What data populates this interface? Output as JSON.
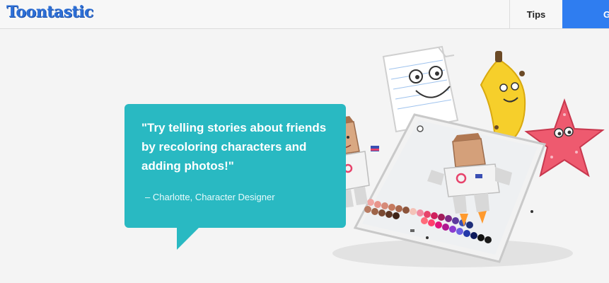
{
  "header": {
    "logo_text": "Toontastic",
    "tips_label": "Tips",
    "cta_label": "G"
  },
  "bubble": {
    "quote": "\"Try telling stories about friends by recoloring characters and adding photos!\"",
    "attribution": "– Charlotte, Character Designer"
  },
  "colors": {
    "brand_blue": "#2f7df0",
    "bubble_teal": "#29b9c2",
    "background": "#f4f4f4"
  },
  "icons": [
    "paper-character-icon",
    "banana-character-icon",
    "starfish-character-icon",
    "tablet-icon",
    "astronaut-character-icon",
    "color-palette-icon"
  ]
}
